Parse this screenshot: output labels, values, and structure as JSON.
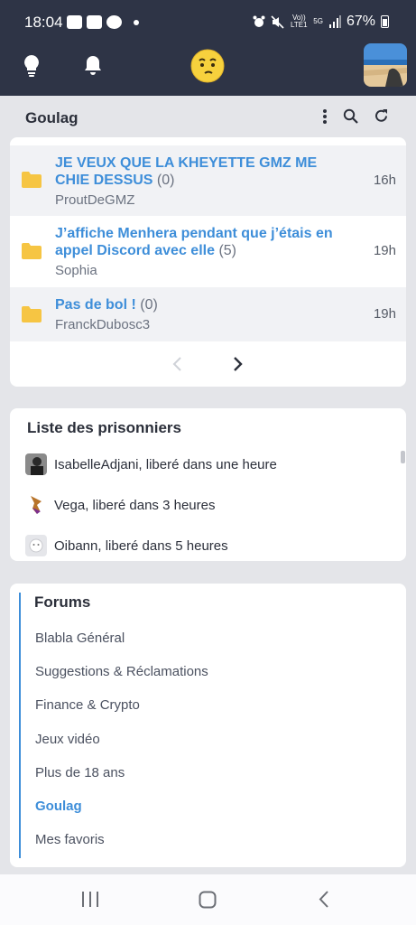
{
  "status_bar": {
    "time": "18:04",
    "network_lte": "Vo)) LTE1",
    "network_5g": "5G",
    "battery": "67%"
  },
  "header": {
    "icons": [
      "lightbulb-icon",
      "bell-icon",
      "smiley-logo-icon",
      "user-avatar"
    ]
  },
  "forum_title": "Goulag",
  "topics": [
    {
      "title": "JE VEUX QUE LA KHEYETTE GMZ ME CHIE DESSUS",
      "count": "(0)",
      "author": "ProutDeGMZ",
      "time": "16h"
    },
    {
      "title": "J’affiche Menhera pendant que j’étais en appel Discord avec elle",
      "count": "(5)",
      "author": "Sophia",
      "time": "19h"
    },
    {
      "title": "Pas de bol !",
      "count": "(0)",
      "author": "FranckDubosc3",
      "time": "19h"
    }
  ],
  "prisoners": {
    "title": "Liste des prisonniers",
    "items": [
      {
        "text": "IsabelleAdjani, liberé dans une heure"
      },
      {
        "text": "Vega, liberé dans 3 heures"
      },
      {
        "text": "Oibann, liberé dans 5 heures"
      }
    ]
  },
  "forums": {
    "title": "Forums",
    "items": [
      {
        "label": "Blabla Général",
        "active": false
      },
      {
        "label": "Suggestions & Réclamations",
        "active": false
      },
      {
        "label": "Finance & Crypto",
        "active": false
      },
      {
        "label": "Jeux vidéo",
        "active": false
      },
      {
        "label": "Plus de 18 ans",
        "active": false
      },
      {
        "label": "Goulag",
        "active": true
      },
      {
        "label": "Mes favoris",
        "active": false
      }
    ]
  },
  "colors": {
    "header_bg": "#2e3446",
    "accent": "#3e8ed9",
    "folder": "#f6c543",
    "page_bg": "#e4e5e9"
  }
}
